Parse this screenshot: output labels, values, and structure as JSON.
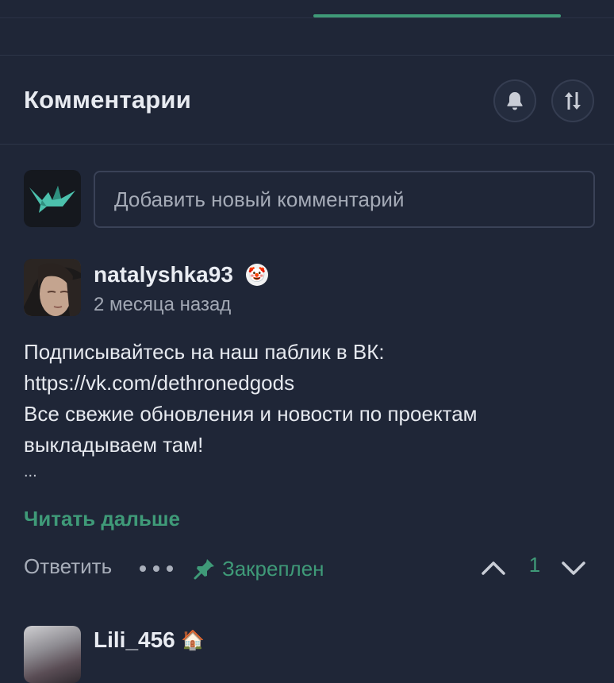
{
  "header": {
    "title": "Комментарии",
    "bell_icon": "bell-icon",
    "sort_icon": "sort-arrows-icon"
  },
  "new_comment": {
    "placeholder": "Добавить новый комментарий",
    "avatar_icon": "paper-crane-logo-icon"
  },
  "comment": {
    "username": "natalyshka93",
    "badge_emoji": "🤡",
    "timestamp": "2 месяца назад",
    "body_lines": [
      "Подписывайтесь на наш паблик в ВК:",
      "https://vk.com/dethronedgods",
      "Все свежие обновления и новости по проектам",
      "выкладываем там!"
    ],
    "truncation": "...",
    "read_more": "Читать дальше",
    "reply_label": "Ответить",
    "pinned_label": "Закреплен",
    "vote_count": "1"
  },
  "next_comment": {
    "username": "Lili_456",
    "badge_emoji": "🏠"
  },
  "colors": {
    "background": "#1f2637",
    "accent": "#3f9a78",
    "muted_text": "#a2a8b4",
    "border": "#3a4257"
  }
}
